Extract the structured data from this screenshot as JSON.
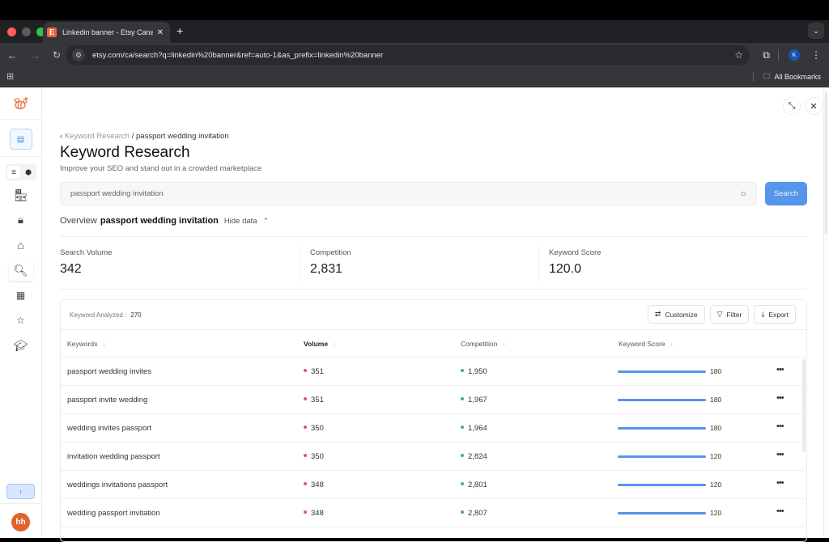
{
  "browser": {
    "tab_title": "Linkedin banner - Etsy Canada",
    "tab_favicon": "E",
    "url": "etsy.com/ca/search?q=linkedin%20banner&ref=auto-1&as_prefix=linkedin%20banner",
    "profile_initial": "K",
    "bookmarks_label": "All Bookmarks"
  },
  "sidebar": {
    "items": [
      {
        "icon": "store-icon"
      },
      {
        "icon": "bag-search-icon"
      },
      {
        "icon": "shop-search-icon"
      },
      {
        "icon": "keyword-search-icon",
        "active": true
      },
      {
        "icon": "calendar-icon"
      },
      {
        "icon": "star-icon"
      },
      {
        "icon": "graduation-cap-icon"
      }
    ],
    "avatar_initials": "hh"
  },
  "page": {
    "breadcrumb_parent": "Keyword Research",
    "breadcrumb_separator": "/",
    "breadcrumb_current": "passport wedding invitation",
    "title": "Keyword Research",
    "subtitle": "Improve your SEO and stand out in a crowded marketplace",
    "search_value": "passport wedding invitation",
    "search_button": "Search",
    "overview_label": "Overview",
    "overview_keyword": "passport wedding invitation",
    "hide_data_label": "Hide data"
  },
  "stats": [
    {
      "label": "Search Volume",
      "value": "342"
    },
    {
      "label": "Competition",
      "value": "2,831"
    },
    {
      "label": "Keyword Score",
      "value": "120.0"
    }
  ],
  "table": {
    "analyzed_label": "Keyword Analyzed :",
    "analyzed_count": "270",
    "tools": {
      "customize": "Customize",
      "filter": "Filter",
      "export": "Export"
    },
    "columns": [
      "Keywords",
      "Volume",
      "Competition",
      "Keyword Score"
    ],
    "colors": {
      "volume_dot": "#e05a4f",
      "competition_dot": "#4caf6a",
      "score_bar": "#5595ec"
    },
    "rows": [
      {
        "keyword": "passport wedding invites",
        "volume": "351",
        "competition": "1,950",
        "score": "180",
        "score_fill": 1.0
      },
      {
        "keyword": "passport invite wedding",
        "volume": "351",
        "competition": "1,967",
        "score": "180",
        "score_fill": 1.0
      },
      {
        "keyword": "wedding invites passport",
        "volume": "350",
        "competition": "1,964",
        "score": "180",
        "score_fill": 1.0
      },
      {
        "keyword": "invitation wedding passport",
        "volume": "350",
        "competition": "2,824",
        "score": "120",
        "score_fill": 1.0
      },
      {
        "keyword": "weddings invitations passport",
        "volume": "348",
        "competition": "2,801",
        "score": "120",
        "score_fill": 1.0
      },
      {
        "keyword": "wedding passport invitation",
        "volume": "348",
        "competition": "2,807",
        "score": "120",
        "score_fill": 1.0
      }
    ]
  }
}
